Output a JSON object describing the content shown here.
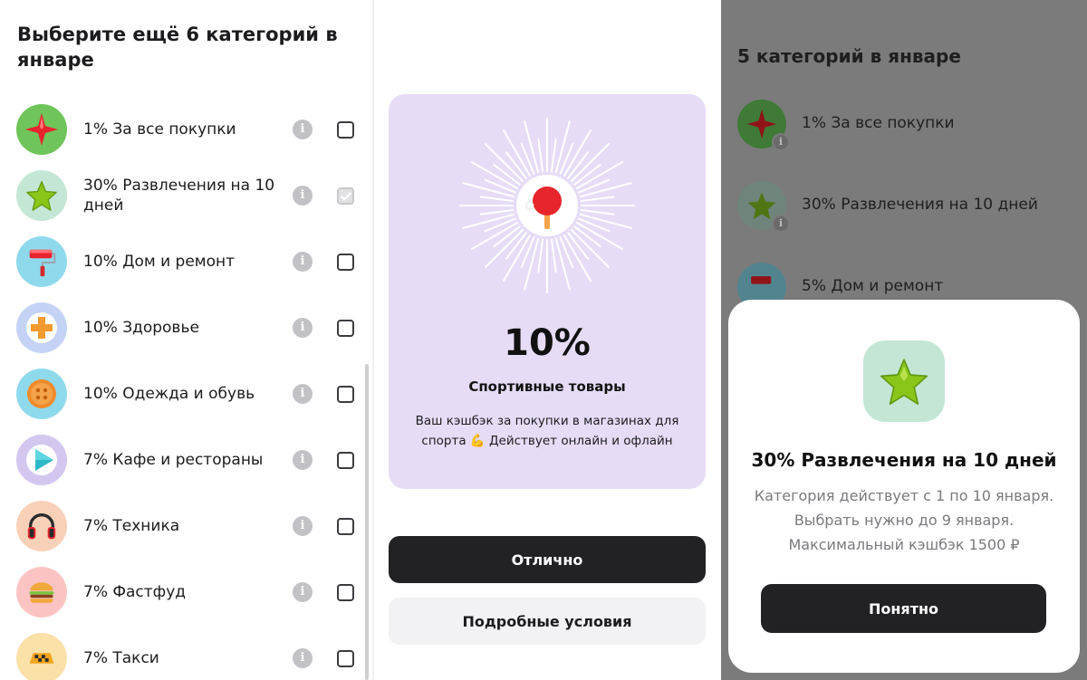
{
  "panel1": {
    "title": "Выберите ещё 6 категорий в январе",
    "info_glyph": "i",
    "categories": [
      {
        "label": "1% За все покупки",
        "icon": "red-sparkle-icon",
        "checked": false
      },
      {
        "label": "30% Развлечения на 10 дней",
        "icon": "green-star-icon",
        "checked": true
      },
      {
        "label": "10% Дом и ремонт",
        "icon": "paint-roller-icon",
        "checked": false
      },
      {
        "label": "10% Здоровье",
        "icon": "medical-cross-icon",
        "checked": false
      },
      {
        "label": "10% Одежда и обувь",
        "icon": "button-icon",
        "checked": false
      },
      {
        "label": "7% Кафе и рестораны",
        "icon": "play-arrow-icon",
        "checked": false
      },
      {
        "label": "7% Техника",
        "icon": "headphones-icon",
        "checked": false
      },
      {
        "label": "7% Фастфуд",
        "icon": "burger-icon",
        "checked": false
      },
      {
        "label": "7% Такси",
        "icon": "taxi-sign-icon",
        "checked": false
      }
    ]
  },
  "panel2": {
    "percent": "10%",
    "category": "Спортивные товары",
    "description": "Ваш кэшбэк за покупки в магазинах для спорта 💪 Действует онлайн и офлайн",
    "primary_button": "Отлично",
    "secondary_button": "Подробные условия",
    "icon": "ping-pong-paddle-icon"
  },
  "panel3": {
    "title": "5 категорий в январе",
    "info_glyph": "i",
    "rows": [
      {
        "label": "1% За все покупки",
        "icon": "red-sparkle-icon"
      },
      {
        "label": "30% Развлечения на 10 дней",
        "icon": "green-star-icon"
      },
      {
        "label": "5% Дом и ремонт",
        "icon": "paint-roller-icon"
      }
    ],
    "sheet": {
      "title": "30% Развлечения на 10 дней",
      "description": "Категория действует с 1 по 10 января. Выбрать нужно до 9 января. Максимальный кэшбэк 1500 ₽",
      "button": "Понятно",
      "icon": "green-star-icon"
    }
  }
}
